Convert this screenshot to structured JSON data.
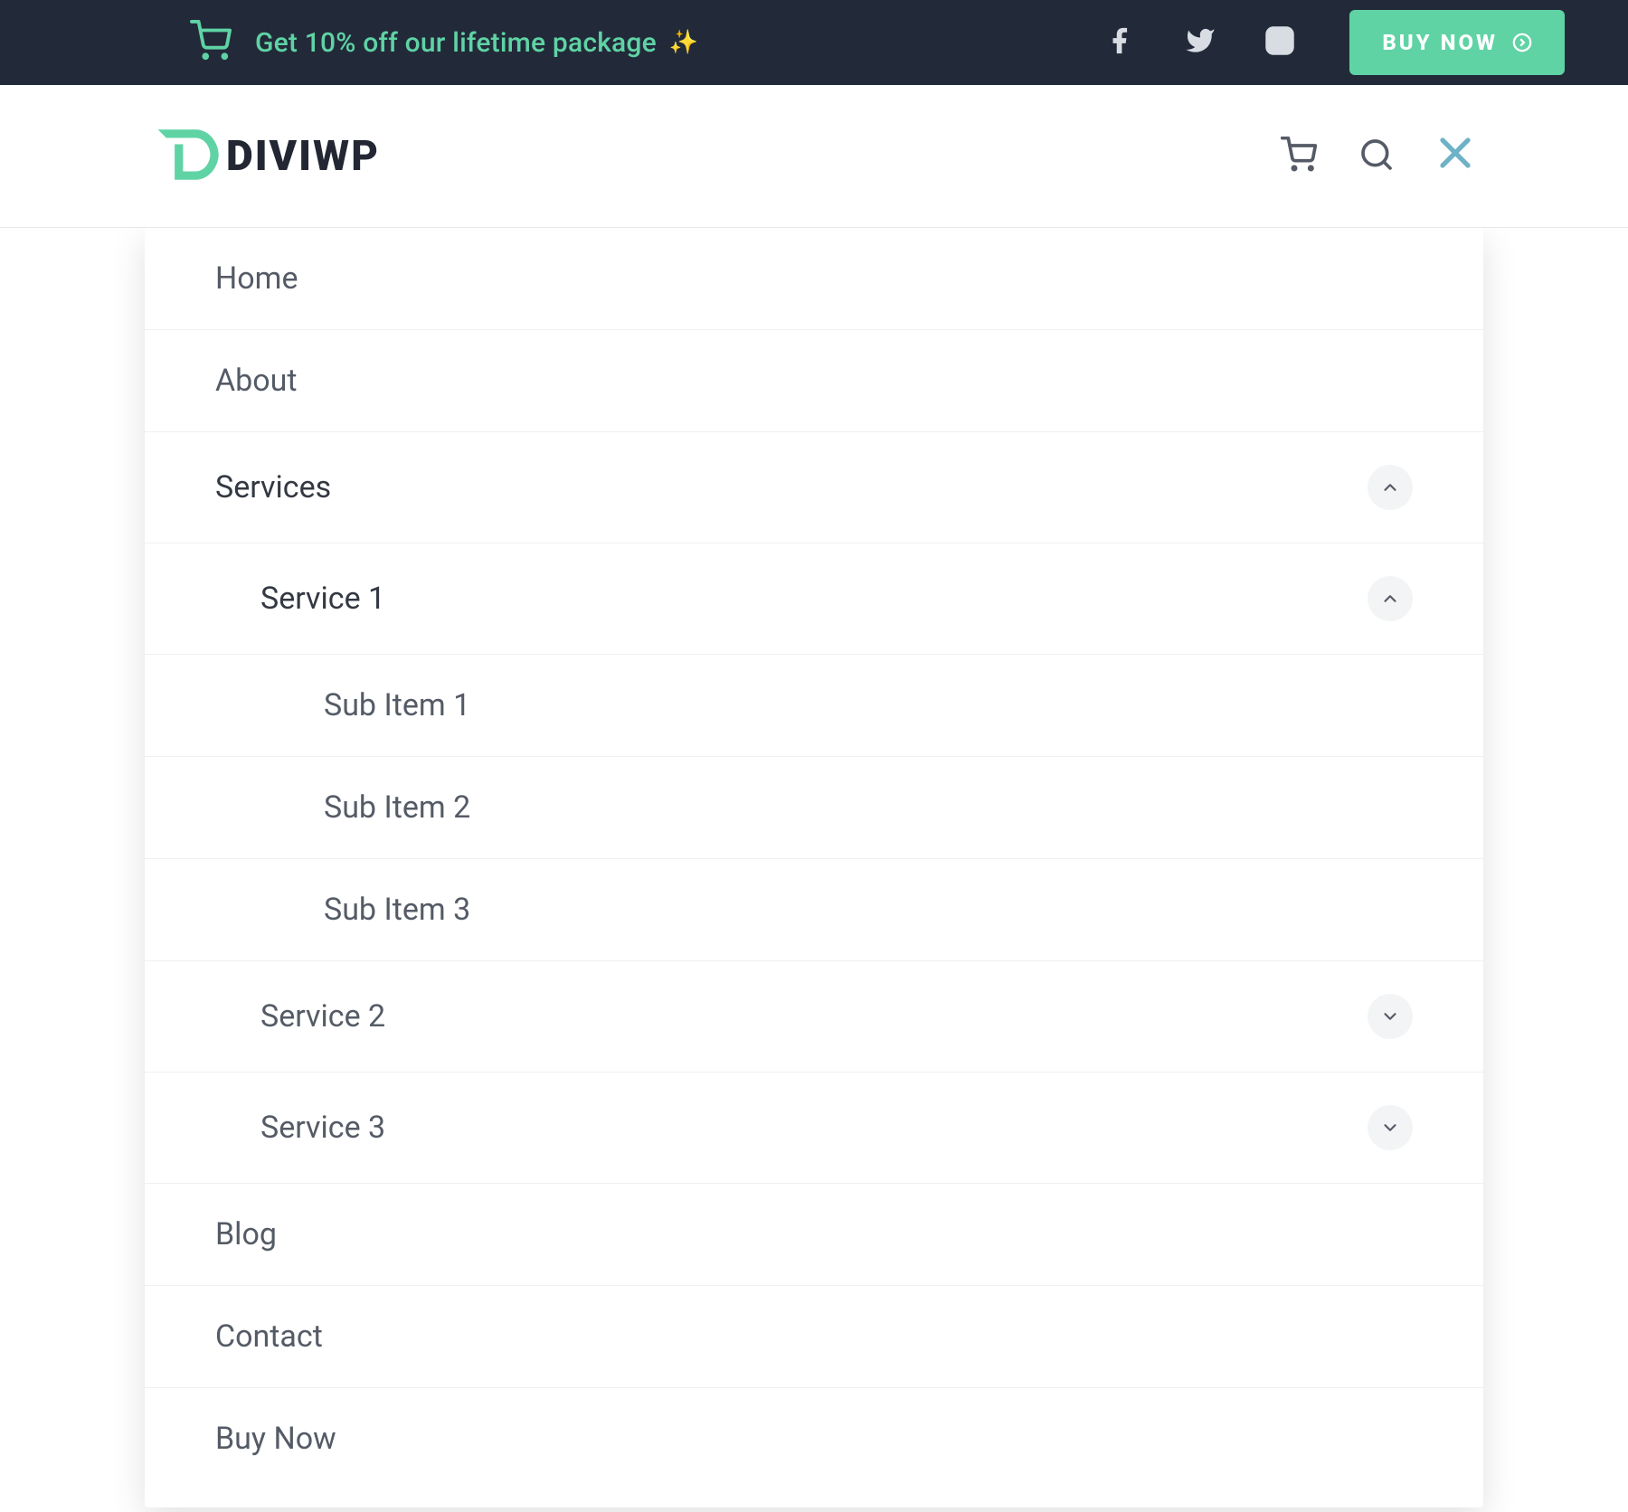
{
  "colors": {
    "accent": "#5fd3a4",
    "topbar_bg": "#222a3a",
    "text_muted": "#555b66",
    "close_icon": "#6fb2c7"
  },
  "topbar": {
    "promo_text": "Get 10% off our lifetime package",
    "promo_emoji": "✨",
    "buy_label": "BUY NOW",
    "social_icons": [
      "facebook",
      "twitter",
      "instagram"
    ]
  },
  "header": {
    "logo_text_prefix": "DIVI",
    "logo_text_suffix": "WP",
    "icons": [
      "cart",
      "search",
      "close"
    ]
  },
  "menu": {
    "items": [
      {
        "label": "Home",
        "level": 1,
        "expandable": false
      },
      {
        "label": "About",
        "level": 1,
        "expandable": false
      },
      {
        "label": "Services",
        "level": 1,
        "expandable": true,
        "expanded": true,
        "active": true
      },
      {
        "label": "Service 1",
        "level": 2,
        "expandable": true,
        "expanded": true,
        "active": true
      },
      {
        "label": "Sub Item 1",
        "level": 3,
        "expandable": false
      },
      {
        "label": "Sub Item 2",
        "level": 3,
        "expandable": false
      },
      {
        "label": "Sub Item 3",
        "level": 3,
        "expandable": false
      },
      {
        "label": "Service 2",
        "level": 2,
        "expandable": true,
        "expanded": false
      },
      {
        "label": "Service 3",
        "level": 2,
        "expandable": true,
        "expanded": false
      },
      {
        "label": "Blog",
        "level": 1,
        "expandable": false
      },
      {
        "label": "Contact",
        "level": 1,
        "expandable": false
      },
      {
        "label": "Buy Now",
        "level": 1,
        "expandable": false
      }
    ]
  }
}
